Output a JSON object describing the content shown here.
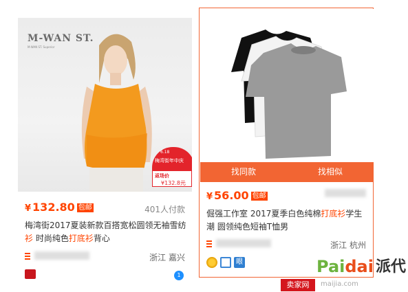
{
  "products": [
    {
      "brand": "M-WAN ST.",
      "brand_sub": "M-WAN ST. Superior",
      "promo_tag": {
        "line1": "6.18",
        "line2": "梅湾街年中庆",
        "line3": "返场价",
        "line4": "¥132.8元"
      },
      "price_symbol": "¥",
      "price": "132.80",
      "free_shipping": "包邮",
      "sales": "401人付款",
      "title_parts": [
        "梅湾街2017夏装新款百搭宽松圆领无袖雪纺",
        "衫",
        " 时尚纯色",
        "打底衫",
        "背心"
      ],
      "shop_name": "",
      "location": "浙江 嘉兴"
    },
    {
      "price_symbol": "¥",
      "price": "56.00",
      "free_shipping": "包邮",
      "sales": "",
      "hover_actions": [
        "找同款",
        "找相似"
      ],
      "title_parts": [
        "倔强工作室 2017夏季白色纯棉",
        "打底衫",
        "学生潮 圆领纯色短袖T恤男"
      ],
      "shop_name": "",
      "location": "浙江 杭州"
    }
  ],
  "watermark": {
    "brand_left": "Pai",
    "brand_mid": "dai",
    "brand_cn": "派代",
    "tag": "卖家网",
    "url": "maijia.com"
  },
  "colors": {
    "accent": "#f26533",
    "price": "#ff4400"
  }
}
